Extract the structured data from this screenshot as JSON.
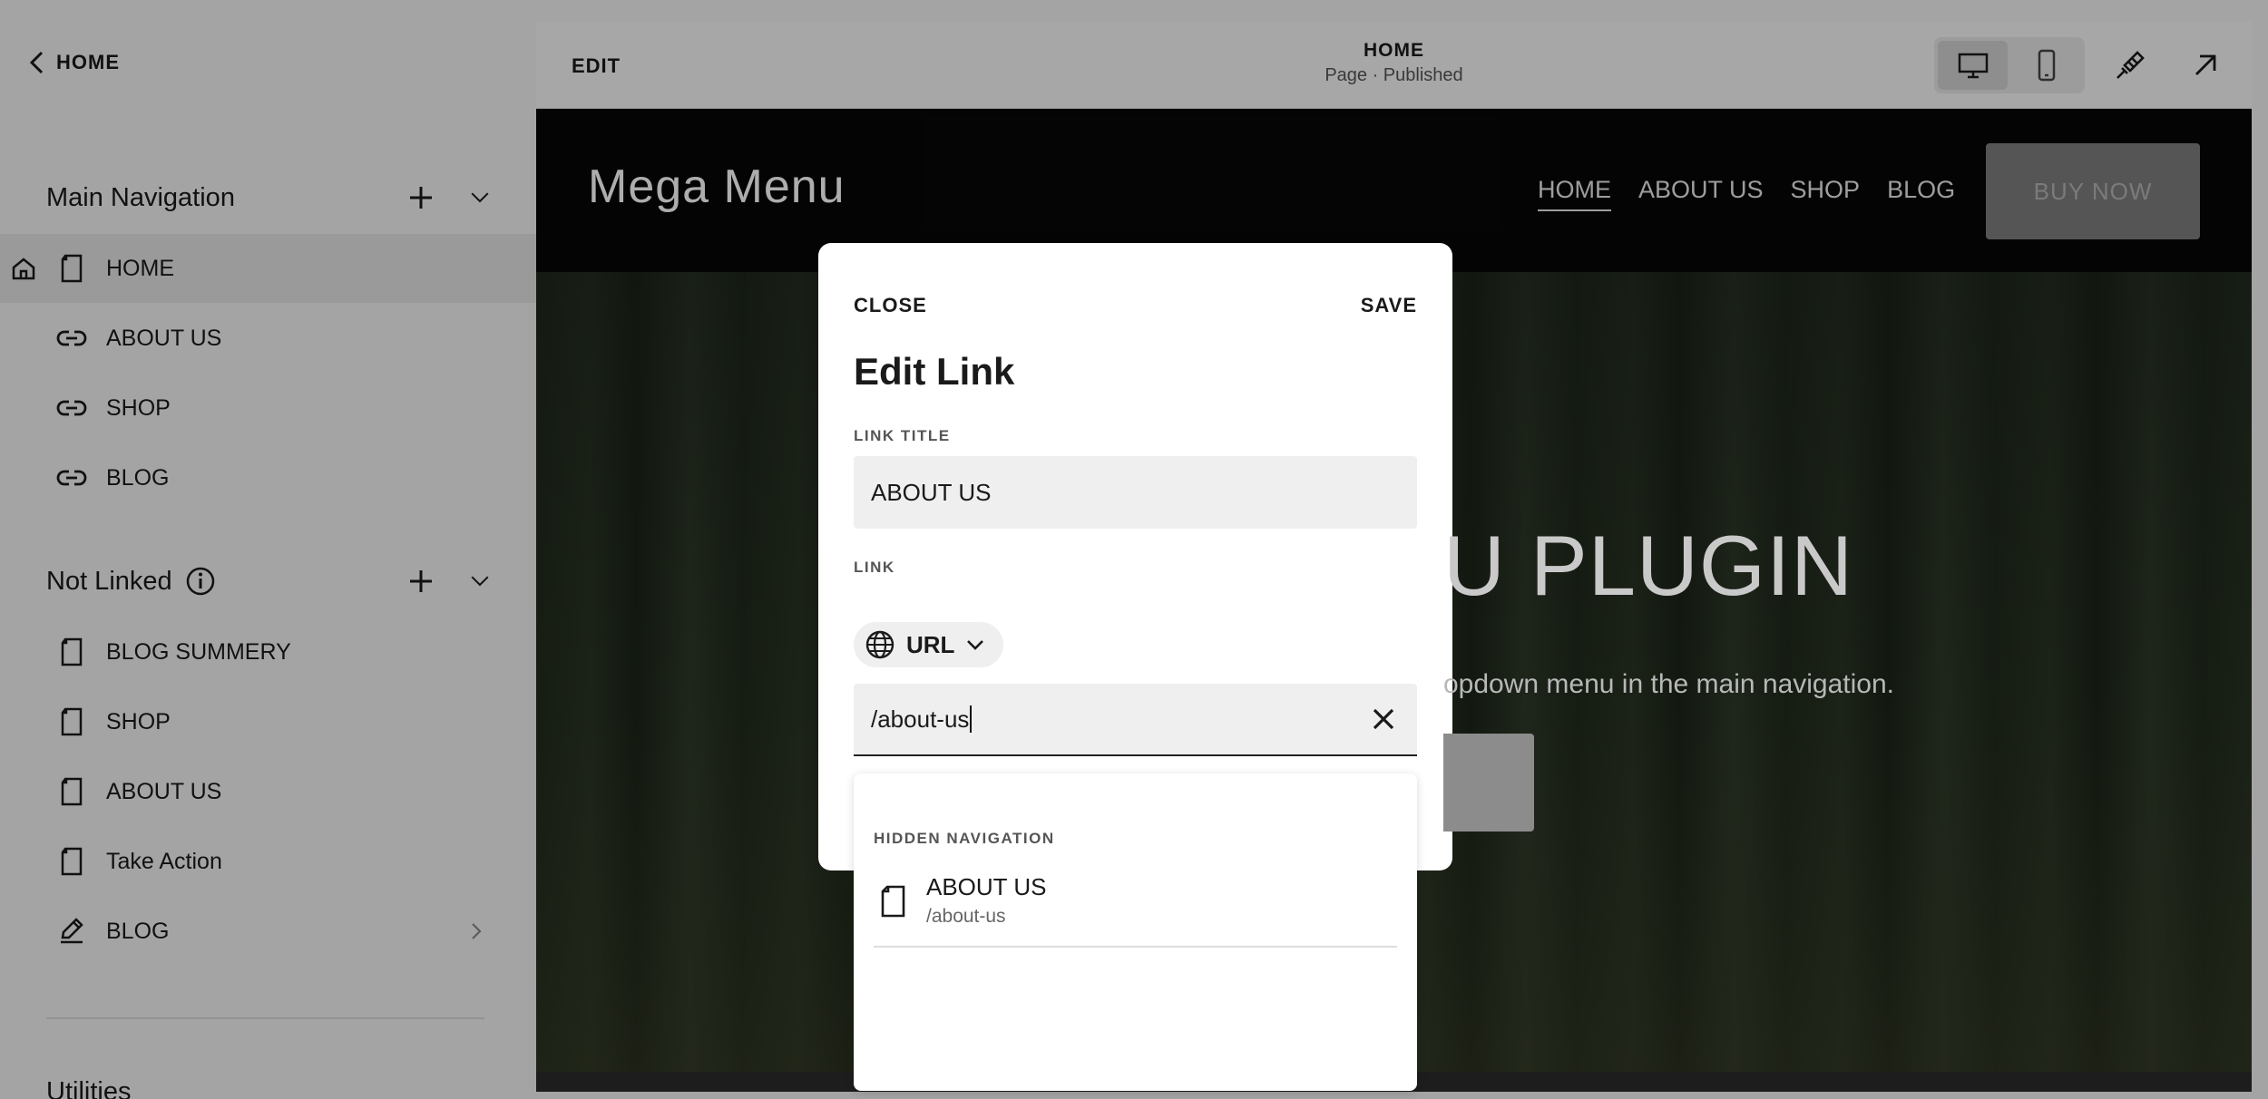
{
  "sidebar": {
    "back_label": "HOME",
    "main_nav": {
      "title": "Main Navigation",
      "items": [
        {
          "label": "HOME",
          "icon": "page-icon",
          "home": true,
          "active": true
        },
        {
          "label": "ABOUT US",
          "icon": "link-icon"
        },
        {
          "label": "SHOP",
          "icon": "link-icon"
        },
        {
          "label": "BLOG",
          "icon": "link-icon"
        }
      ]
    },
    "not_linked": {
      "title": "Not Linked",
      "items": [
        {
          "label": "BLOG SUMMERY",
          "icon": "page-icon"
        },
        {
          "label": "SHOP",
          "icon": "page-icon"
        },
        {
          "label": "ABOUT US",
          "icon": "page-icon"
        },
        {
          "label": "Take Action",
          "icon": "page-icon"
        },
        {
          "label": "BLOG",
          "icon": "blog-icon",
          "has_children": true
        }
      ]
    },
    "utilities_title": "Utilities"
  },
  "topbar": {
    "edit_label": "EDIT",
    "page_title": "HOME",
    "page_status": "Page · Published"
  },
  "site": {
    "logo": "Mega Menu",
    "nav": [
      "HOME",
      "ABOUT US",
      "SHOP",
      "BLOG"
    ],
    "buy_label": "BUY NOW",
    "hero_title": "U PLUGIN",
    "hero_subtitle": "opdown menu in the main navigation."
  },
  "modal": {
    "close_label": "CLOSE",
    "save_label": "SAVE",
    "title": "Edit Link",
    "link_title_label": "LINK TITLE",
    "link_title_value": "ABOUT US",
    "link_label": "LINK",
    "link_type": "URL",
    "url_value": "/about-us"
  },
  "dropdown": {
    "section_label": "HIDDEN NAVIGATION",
    "items": [
      {
        "title": "ABOUT US",
        "path": "/about-us"
      }
    ]
  },
  "colors": {
    "sidebar_bg": "#f2f2f2",
    "active_row": "#e3e3e3",
    "site_header": "#070707",
    "buy_button": "#7e7e7e"
  }
}
